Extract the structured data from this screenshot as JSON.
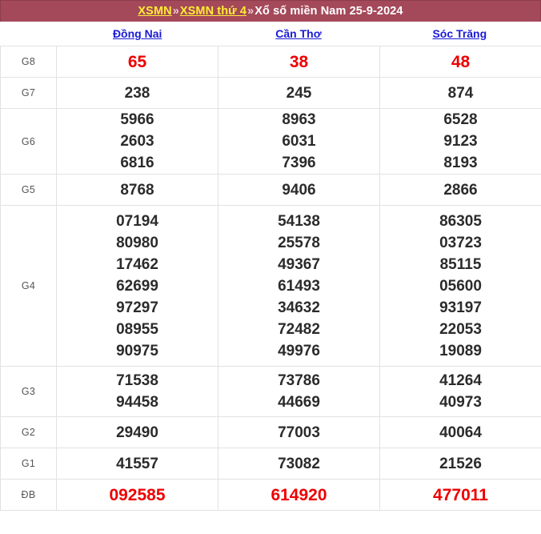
{
  "header": {
    "link1": "XSMN",
    "sep1": "»",
    "link2": "XSMN thứ 4",
    "sep2": "»",
    "tail": "Xổ số miền Nam 25-9-2024",
    "bg_color": "#a4495a",
    "link_color": "#ffee33",
    "text_color": "#ffffff"
  },
  "columns": [
    {
      "name": "Đồng Nai"
    },
    {
      "name": "Cần Thơ"
    },
    {
      "name": "Sóc Trăng"
    }
  ],
  "colors": {
    "highlight": "#ee0000",
    "number": "#2b2b2b",
    "label": "#555555",
    "province_link": "#1a1ad6",
    "grid": "#e2e2e2"
  },
  "rows": [
    {
      "label": "G8",
      "highlight": true,
      "cells": [
        [
          "65"
        ],
        [
          "38"
        ],
        [
          "48"
        ]
      ]
    },
    {
      "label": "G7",
      "highlight": false,
      "cells": [
        [
          "238"
        ],
        [
          "245"
        ],
        [
          "874"
        ]
      ]
    },
    {
      "label": "G6",
      "highlight": false,
      "cells": [
        [
          "5966",
          "2603",
          "6816"
        ],
        [
          "8963",
          "6031",
          "7396"
        ],
        [
          "6528",
          "9123",
          "8193"
        ]
      ]
    },
    {
      "label": "G5",
      "highlight": false,
      "cells": [
        [
          "8768"
        ],
        [
          "9406"
        ],
        [
          "2866"
        ]
      ]
    },
    {
      "label": "G4",
      "highlight": false,
      "cells": [
        [
          "07194",
          "80980",
          "17462",
          "62699",
          "97297",
          "08955",
          "90975"
        ],
        [
          "54138",
          "25578",
          "49367",
          "61493",
          "34632",
          "72482",
          "49976"
        ],
        [
          "86305",
          "03723",
          "85115",
          "05600",
          "93197",
          "22053",
          "19089"
        ]
      ]
    },
    {
      "label": "G3",
      "highlight": false,
      "cells": [
        [
          "71538",
          "94458"
        ],
        [
          "73786",
          "44669"
        ],
        [
          "41264",
          "40973"
        ]
      ]
    },
    {
      "label": "G2",
      "highlight": false,
      "cells": [
        [
          "29490"
        ],
        [
          "77003"
        ],
        [
          "40064"
        ]
      ]
    },
    {
      "label": "G1",
      "highlight": false,
      "cells": [
        [
          "41557"
        ],
        [
          "73082"
        ],
        [
          "21526"
        ]
      ]
    },
    {
      "label": "ĐB",
      "highlight": true,
      "cells": [
        [
          "092585"
        ],
        [
          "614920"
        ],
        [
          "477011"
        ]
      ]
    }
  ]
}
